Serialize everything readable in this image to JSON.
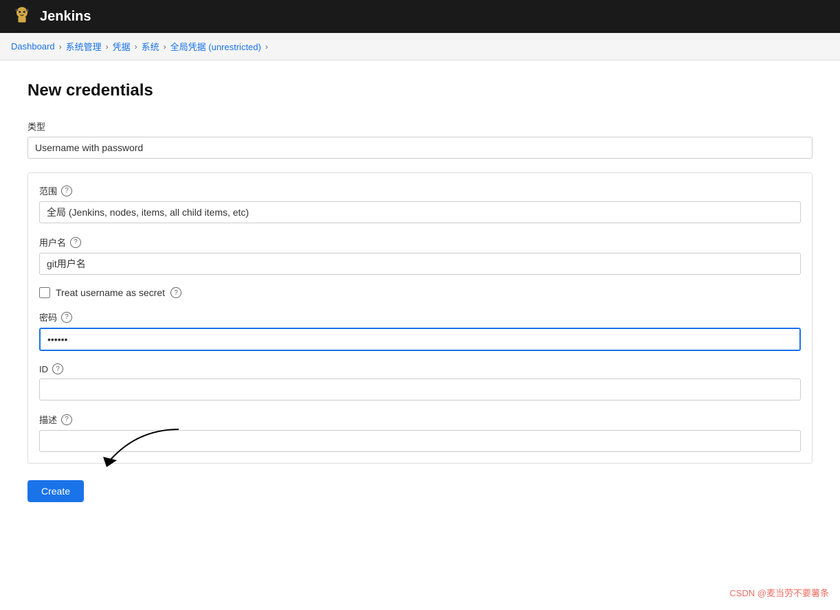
{
  "header": {
    "title": "Jenkins",
    "logo_alt": "jenkins-logo"
  },
  "breadcrumb": {
    "items": [
      {
        "label": "Dashboard",
        "href": "#"
      },
      {
        "label": "系统管理",
        "href": "#"
      },
      {
        "label": "凭据",
        "href": "#"
      },
      {
        "label": "系统",
        "href": "#"
      },
      {
        "label": "全局凭据 (unrestricted)",
        "href": "#"
      }
    ],
    "separator": "›"
  },
  "page": {
    "title": "New credentials"
  },
  "form": {
    "type_label": "类型",
    "type_value": "Username with password",
    "scope_label": "范围",
    "scope_value": "全局 (Jenkins, nodes, items, all child items, etc)",
    "username_label": "用户名",
    "username_value": "git用户名",
    "treat_username_label": "Treat username as secret",
    "password_label": "密码",
    "password_value": "••••••",
    "id_label": "ID",
    "id_value": "",
    "description_label": "描述",
    "description_value": "",
    "create_button": "Create",
    "help_icon": "?"
  },
  "watermark": {
    "text": "CSDN @麦当劳不要薯条"
  }
}
